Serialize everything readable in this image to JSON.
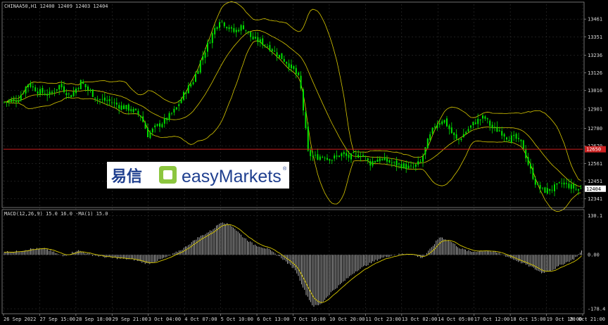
{
  "header": {
    "symbol_line": "CHINAA50,H1  12400 12409 12403 12404",
    "macd_line": "MACD(12,26,9)  15.0  16.0  -MA(1)  15.0"
  },
  "colors": {
    "background": "#000000",
    "bull_candle": "#00e000",
    "band": "#d8c800",
    "macd_hist": "#d8d8d8",
    "signal": "#d8c800",
    "price_line": "#cc2020",
    "current_tag": "#ffffff",
    "grid": "#3a3a3a"
  },
  "logo": {
    "chinese": "易信",
    "brand": "easyMarkets",
    "mark": "®",
    "icon": "leaf-square-icon"
  },
  "chart_data": [
    {
      "type": "candlestick",
      "symbol": "CHINAA50",
      "timeframe": "H1",
      "ohlc_last": {
        "open": 12400,
        "high": 12409,
        "low": 12403,
        "close": 12404
      },
      "y_ticks": [
        "13461",
        "13351",
        "13236",
        "13126",
        "13016",
        "12901",
        "12780",
        "12670",
        "12561",
        "12451",
        "12341"
      ],
      "y_tick_values": [
        13461,
        13351,
        13236,
        13126,
        13016,
        12901,
        12780,
        12670,
        12561,
        12451,
        12341
      ],
      "ylim": [
        12300,
        13510
      ],
      "price_line": {
        "value": 12650,
        "label": "12650"
      },
      "current_price": {
        "value": 12404,
        "label": "12404"
      },
      "x_ticks": [
        "26 Sep 2022",
        "27 Sep 15:00",
        "28 Sep 18:00",
        "29 Sep 21:00",
        "3 Oct 04:00",
        "4 Oct 07:00",
        "5 Oct 10:00",
        "6 Oct 13:00",
        "7 Oct 16:00",
        "10 Oct 20:00",
        "11 Oct 23:00",
        "13 Oct 02:00",
        "14 Oct 05:00",
        "17 Oct 12:00",
        "18 Oct 15:00",
        "19 Oct 18:00",
        "20 Oct 21:00"
      ],
      "close_profile": [
        [
          0,
          12940
        ],
        [
          12,
          12950
        ],
        [
          25,
          12960
        ],
        [
          40,
          13060
        ],
        [
          55,
          13010
        ],
        [
          70,
          12990
        ],
        [
          85,
          13050
        ],
        [
          100,
          12980
        ],
        [
          115,
          13070
        ],
        [
          125,
          13020
        ],
        [
          140,
          12960
        ],
        [
          155,
          12950
        ],
        [
          170,
          12920
        ],
        [
          185,
          12900
        ],
        [
          200,
          12860
        ],
        [
          210,
          12740
        ],
        [
          222,
          12790
        ],
        [
          235,
          12830
        ],
        [
          250,
          12900
        ],
        [
          262,
          13000
        ],
        [
          275,
          13080
        ],
        [
          285,
          13200
        ],
        [
          295,
          13300
        ],
        [
          305,
          13400
        ],
        [
          312,
          13460
        ],
        [
          322,
          13420
        ],
        [
          333,
          13380
        ],
        [
          345,
          13420
        ],
        [
          358,
          13340
        ],
        [
          370,
          13320
        ],
        [
          382,
          13290
        ],
        [
          395,
          13240
        ],
        [
          408,
          13190
        ],
        [
          418,
          13140
        ],
        [
          426,
          13080
        ],
        [
          432,
          12860
        ],
        [
          438,
          12620
        ],
        [
          448,
          12600
        ],
        [
          460,
          12610
        ],
        [
          472,
          12590
        ],
        [
          485,
          12620
        ],
        [
          495,
          12600
        ],
        [
          505,
          12610
        ],
        [
          515,
          12620
        ],
        [
          525,
          12560
        ],
        [
          535,
          12590
        ],
        [
          548,
          12580
        ],
        [
          560,
          12560
        ],
        [
          572,
          12550
        ],
        [
          585,
          12530
        ],
        [
          598,
          12570
        ],
        [
          608,
          12700
        ],
        [
          618,
          12800
        ],
        [
          630,
          12840
        ],
        [
          642,
          12750
        ],
        [
          650,
          12700
        ],
        [
          662,
          12760
        ],
        [
          675,
          12820
        ],
        [
          688,
          12850
        ],
        [
          700,
          12780
        ],
        [
          712,
          12760
        ],
        [
          722,
          12720
        ],
        [
          732,
          12720
        ],
        [
          742,
          12680
        ],
        [
          752,
          12540
        ],
        [
          762,
          12430
        ],
        [
          772,
          12390
        ],
        [
          782,
          12400
        ],
        [
          792,
          12420
        ],
        [
          800,
          12440
        ],
        [
          810,
          12420
        ],
        [
          820,
          12400
        ],
        [
          828,
          12404
        ]
      ]
    },
    {
      "type": "histogram",
      "name": "MACD(12,26,9)",
      "values_shown": [
        15.0,
        16.0
      ],
      "signal_ma": "-MA(1) 15.0",
      "y_ticks": [
        "130.1",
        "0.00",
        "-178.4"
      ],
      "y_tick_values": [
        130.1,
        0.0,
        -178.4
      ],
      "ylim": [
        -190,
        140
      ],
      "profile": [
        [
          0,
          10
        ],
        [
          20,
          10
        ],
        [
          45,
          20
        ],
        [
          65,
          20
        ],
        [
          90,
          -5
        ],
        [
          110,
          15
        ],
        [
          130,
          0
        ],
        [
          150,
          -8
        ],
        [
          170,
          -12
        ],
        [
          190,
          -16
        ],
        [
          210,
          -30
        ],
        [
          225,
          -18
        ],
        [
          240,
          -5
        ],
        [
          260,
          20
        ],
        [
          280,
          55
        ],
        [
          300,
          80
        ],
        [
          315,
          110
        ],
        [
          330,
          95
        ],
        [
          345,
          60
        ],
        [
          360,
          35
        ],
        [
          380,
          20
        ],
        [
          400,
          -10
        ],
        [
          420,
          -50
        ],
        [
          435,
          -130
        ],
        [
          445,
          -170
        ],
        [
          455,
          -165
        ],
        [
          470,
          -125
        ],
        [
          490,
          -85
        ],
        [
          505,
          -55
        ],
        [
          520,
          -35
        ],
        [
          540,
          -12
        ],
        [
          560,
          0
        ],
        [
          580,
          5
        ],
        [
          600,
          -10
        ],
        [
          612,
          20
        ],
        [
          625,
          60
        ],
        [
          640,
          45
        ],
        [
          655,
          20
        ],
        [
          670,
          10
        ],
        [
          690,
          15
        ],
        [
          710,
          5
        ],
        [
          725,
          -10
        ],
        [
          740,
          -25
        ],
        [
          755,
          -40
        ],
        [
          770,
          -60
        ],
        [
          785,
          -50
        ],
        [
          800,
          -30
        ],
        [
          815,
          -15
        ],
        [
          828,
          15
        ]
      ]
    }
  ]
}
